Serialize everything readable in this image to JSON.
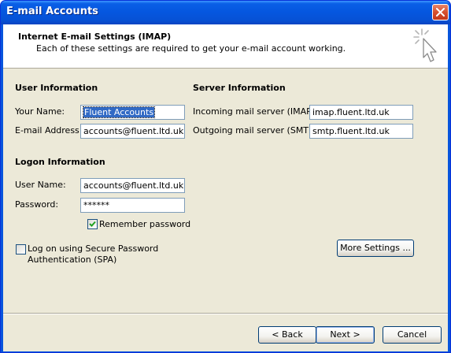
{
  "window": {
    "title": "E-mail Accounts"
  },
  "header": {
    "title": "Internet E-mail Settings (IMAP)",
    "subtitle": "Each of these settings are required to get your e-mail account working."
  },
  "user_info": {
    "heading": "User Information",
    "name_label": "Your Name:",
    "name_value": "Fluent Accounts",
    "email_label": "E-mail Address:",
    "email_value": "accounts@fluent.ltd.uk"
  },
  "server_info": {
    "heading": "Server Information",
    "incoming_label": "Incoming mail server (IMAP):",
    "incoming_value": "imap.fluent.ltd.uk",
    "outgoing_label": "Outgoing mail server (SMTP):",
    "outgoing_value": "smtp.fluent.ltd.uk"
  },
  "logon_info": {
    "heading": "Logon Information",
    "username_label": "User Name:",
    "username_value": "accounts@fluent.ltd.uk",
    "password_label": "Password:",
    "password_value": "******",
    "remember_label": "Remember password",
    "remember_checked": true
  },
  "spa": {
    "label_line1": "Log on using Secure Password",
    "label_line2": "Authentication (SPA)",
    "checked": false
  },
  "buttons": {
    "more_settings": "More Settings ...",
    "back": "< Back",
    "next": "Next >",
    "cancel": "Cancel"
  },
  "icons": {
    "close": "close-icon",
    "wizard": "cursor-sparkle-icon",
    "checkmark": "checkmark-icon"
  },
  "colors": {
    "titlebar": "#0a5fe6",
    "dialog_bg": "#ece9d8",
    "selection": "#316ac5",
    "close_button": "#d6502e"
  }
}
